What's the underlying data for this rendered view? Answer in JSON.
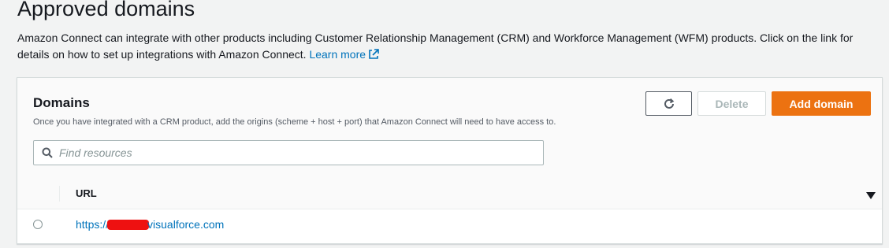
{
  "page": {
    "title": "Approved domains",
    "description": "Amazon Connect can integrate with other products including Customer Relationship Management (CRM) and Workforce Management (WFM) products. Click on the link for details on how to set up integrations with Amazon Connect.",
    "learn_more_label": "Learn more"
  },
  "domains_panel": {
    "title": "Domains",
    "description": "Once you have integrated with a CRM product, add the origins (scheme + host + port) that Amazon Connect will need to have access to.",
    "refresh_icon": "refresh-icon",
    "delete_label": "Delete",
    "add_label": "Add domain",
    "search_placeholder": "Find resources",
    "search_value": ""
  },
  "table": {
    "columns": [
      "URL"
    ],
    "rows": [
      {
        "url_prefix": "https://",
        "url_suffix": "visualforce.com",
        "selected": false
      }
    ]
  },
  "colors": {
    "accent_orange": "#ec7211",
    "link_blue": "#0073bb",
    "redaction_red": "#ee1111"
  }
}
